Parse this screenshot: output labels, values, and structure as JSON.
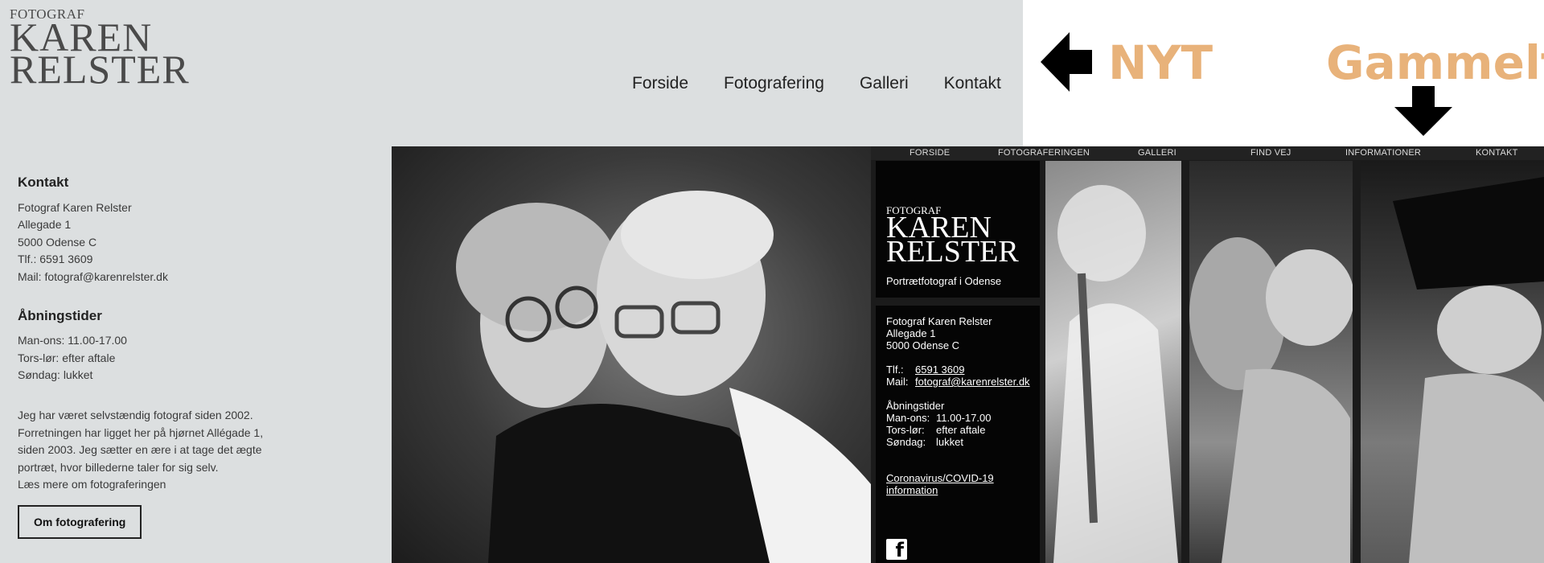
{
  "new_site": {
    "logo": {
      "pre": "FOTOGRAF",
      "line1": "KAREN",
      "line2": "RELSTER"
    },
    "nav": [
      "Forside",
      "Fotografering",
      "Galleri",
      "Kontakt"
    ],
    "contact": {
      "heading": "Kontakt",
      "lines": [
        "Fotograf Karen Relster",
        "Allegade 1",
        "5000 Odense C",
        "Tlf.: 6591 3609",
        "Mail: fotograf@karenrelster.dk"
      ]
    },
    "hours": {
      "heading": "Åbningstider",
      "lines": [
        "Man-ons: 11.00-17.00",
        "Tors-lør: efter aftale",
        "Søndag: lukket"
      ]
    },
    "about": {
      "lines": [
        "Jeg har været selvstændig fotograf siden 2002.",
        "Forretningen har ligget her på hjørnet Allégade 1,",
        "siden 2003. Jeg sætter en ære i at tage det ægte",
        "portræt, hvor billederne taler for sig selv.",
        "Læs mere om fotograferingen"
      ],
      "button": "Om fotografering"
    }
  },
  "labels": {
    "new": "NYT",
    "old": "Gammelt"
  },
  "old_site": {
    "nav": [
      "FORSIDE",
      "FOTOGRAFERINGEN",
      "GALLERI",
      "FIND VEJ",
      "INFORMATIONER",
      "KONTAKT"
    ],
    "logo": {
      "pre": "FOTOGRAF",
      "line1": "KAREN",
      "line2": "RELSTER",
      "tagline": "Portrætfotograf i Odense"
    },
    "info": {
      "name": "Fotograf Karen Relster",
      "street": "Allegade 1",
      "city": "5000 Odense C",
      "tlf_label": "Tlf.:",
      "tlf": "6591 3609",
      "mail_label": "Mail:",
      "mail": "fotograf@karenrelster.dk",
      "hours_heading": "Åbningstider",
      "hours": [
        {
          "day": "Man-ons:",
          "time": "11.00-17.00"
        },
        {
          "day": "Tors-lør:",
          "time": "efter aftale"
        },
        {
          "day": "Søndag:",
          "time": "lukket"
        }
      ],
      "covid_1": "Coronavirus/COVID-19",
      "covid_2": "information",
      "fb": "f"
    }
  },
  "colors": {
    "accent": "#e8b27a",
    "page_bg": "#dcdfe0",
    "old_bg": "#1b1b1b"
  }
}
